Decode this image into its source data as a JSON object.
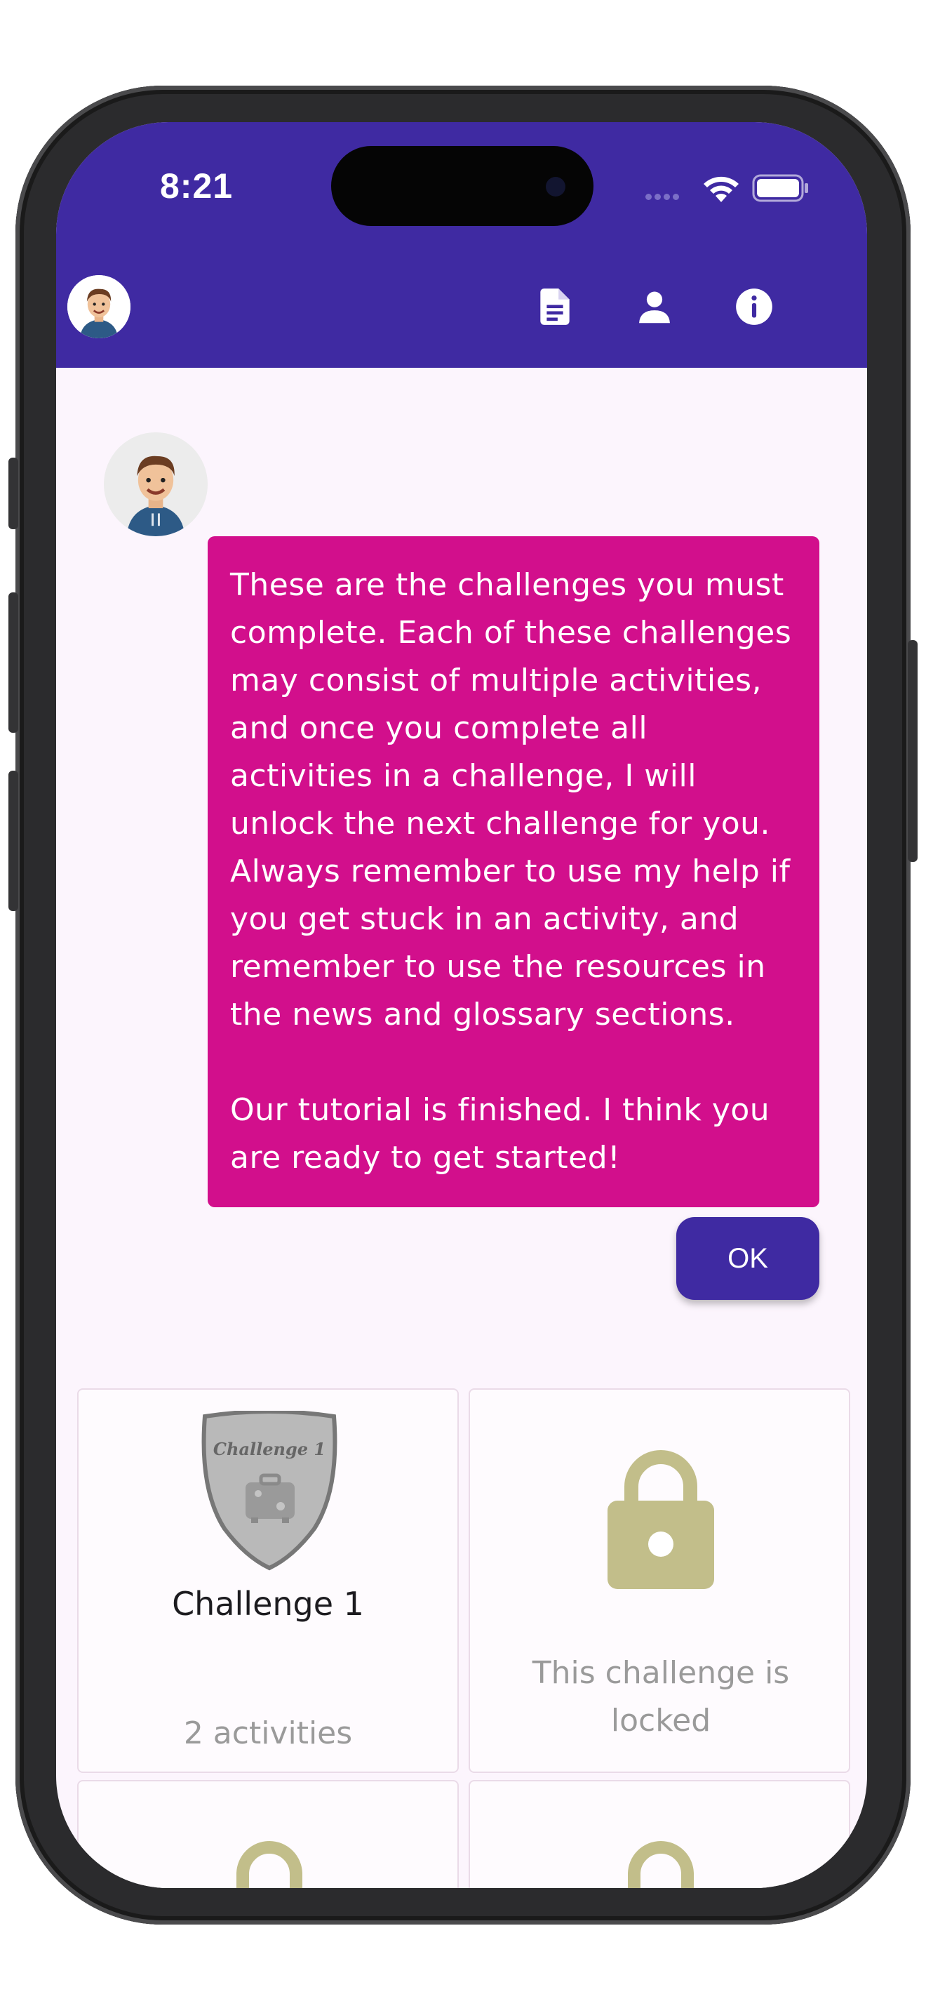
{
  "status": {
    "time": "8:21"
  },
  "appbar": {
    "avatar": "avatar-icon",
    "actions": [
      "document-icon",
      "person-icon",
      "info-icon"
    ]
  },
  "tutorial": {
    "paragraphs": [
      "These are the challenges you must complete. Each of these challenges may consist of multiple activities, and once you complete all activities in a challenge, I will unlock the next challenge for you. Always remember to use my help if you get stuck in an activity, and remember to use the resources in the news and glossary sections.",
      "Our tutorial is finished. I think you are ready to get started!"
    ],
    "ok_label": "OK"
  },
  "challenges": [
    {
      "title": "Challenge 1",
      "badge_text": "Challenge 1",
      "subtitle": "2 activities",
      "locked": false
    },
    {
      "locked_text": "This challenge is locked",
      "locked": true
    },
    {
      "locked": true
    },
    {
      "locked": true
    }
  ],
  "colors": {
    "primary": "#3f2aa2",
    "bubble": "#d20f8c",
    "background": "#fcf5fd",
    "lock": "#c2be8a"
  }
}
